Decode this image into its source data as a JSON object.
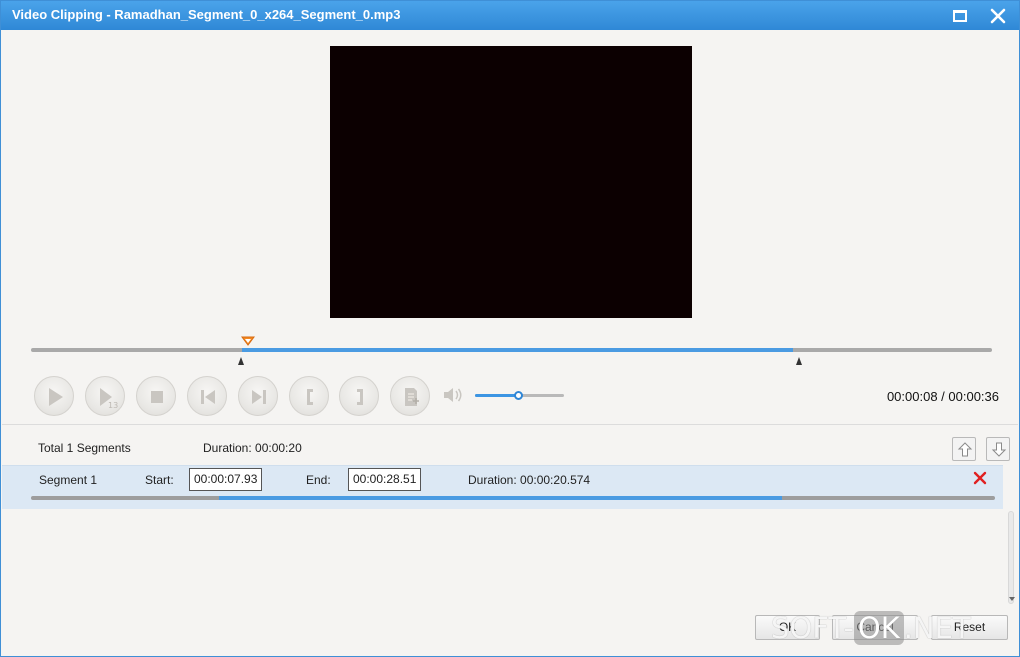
{
  "window": {
    "title": "Video Clipping - Ramadhan_Segment_0_x264_Segment_0.mp3",
    "maximize_icon": "maximize-icon",
    "close_icon": "close-icon"
  },
  "player": {
    "time_readout": "00:00:08 / 00:00:36",
    "timeline_range": {
      "start_fraction": 0.22,
      "end_fraction": 0.793
    },
    "playhead_fraction": 0.22,
    "volume_fraction": 0.5,
    "accent_color": "#4a9be2",
    "controls": [
      {
        "name": "play-button",
        "icon": "play-icon"
      },
      {
        "name": "next-frame-button",
        "icon": "step-frame-icon"
      },
      {
        "name": "stop-button",
        "icon": "stop-icon"
      },
      {
        "name": "previous-button",
        "icon": "skip-back-icon"
      },
      {
        "name": "next-button",
        "icon": "skip-forward-icon"
      },
      {
        "name": "set-start-button",
        "icon": "bracket-left-icon"
      },
      {
        "name": "set-end-button",
        "icon": "bracket-right-icon"
      },
      {
        "name": "add-segment-button",
        "icon": "add-segment-icon"
      }
    ]
  },
  "segments": {
    "total_label": "Total 1 Segments",
    "duration_label": "Duration: 00:00:20",
    "move_up_icon": "arrow-up-icon",
    "move_down_icon": "arrow-down-icon",
    "items": [
      {
        "name": "Segment 1",
        "start_label": "Start:",
        "start_value": "00:00:07.93",
        "end_label": "End:",
        "end_value": "00:00:28.51",
        "duration": "Duration: 00:00:20.574",
        "delete_icon": "delete-icon",
        "delete_color": "#e02020",
        "range": {
          "start_fraction": 0.195,
          "end_fraction": 0.779
        }
      }
    ]
  },
  "footer": {
    "ok_label": "OK",
    "cancel_label": "Cancel",
    "reset_label": "Reset"
  },
  "watermark": {
    "soft_text": "SOFT-",
    "ok_text": "OK",
    "net_text": ".NET"
  }
}
